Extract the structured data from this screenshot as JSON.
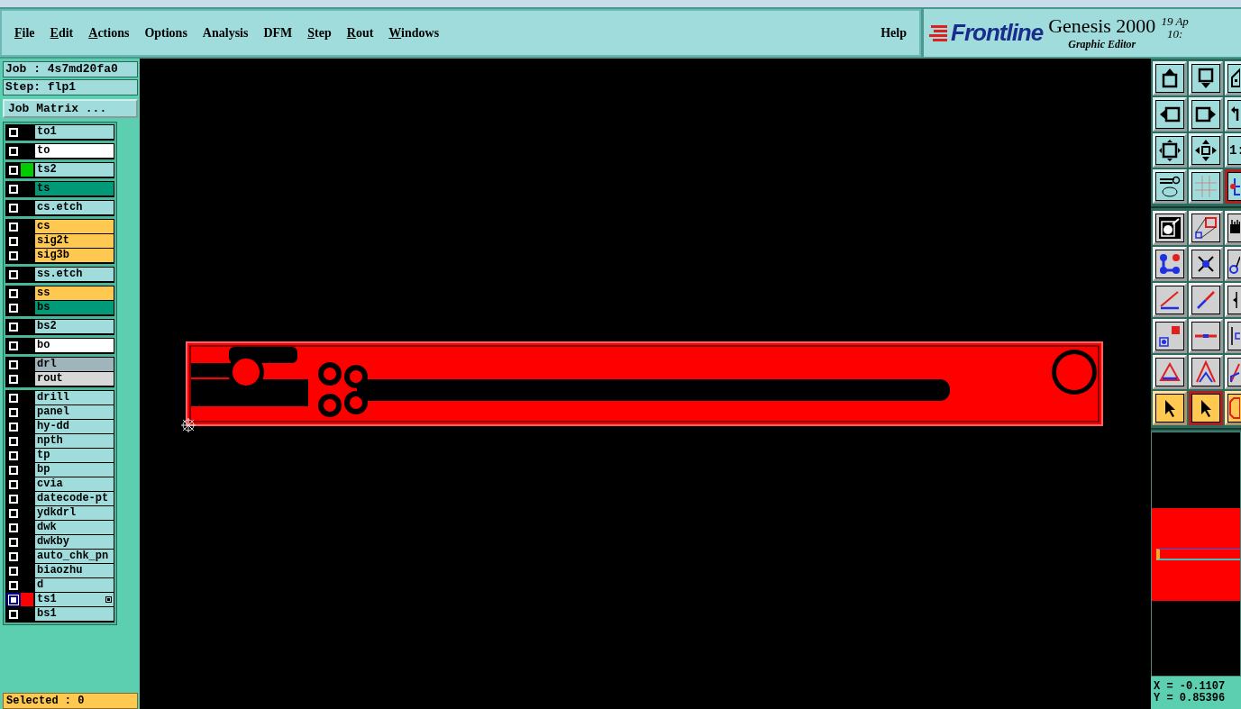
{
  "menu": [
    {
      "label": "File",
      "mnemonic": true
    },
    {
      "label": "Edit",
      "mnemonic": true
    },
    {
      "label": "Actions",
      "mnemonic": true
    },
    {
      "label": "Options",
      "mnemonic": false
    },
    {
      "label": "Analysis",
      "mnemonic": false
    },
    {
      "label": "DFM",
      "mnemonic": false
    },
    {
      "label": "Step",
      "mnemonic": true
    },
    {
      "label": "Rout",
      "mnemonic": true
    },
    {
      "label": "Windows",
      "mnemonic": true
    }
  ],
  "help": "Help",
  "brand": {
    "logo": "Frontline",
    "product": "Genesis 2000",
    "subtitle": "Graphic Editor",
    "date": "19 Ap",
    "time": "10:"
  },
  "job": "Job : 4s7md20fa0",
  "step": "Step: flp1",
  "job_matrix": "Job Matrix ...",
  "layer_groups": [
    {
      "layers": [
        {
          "name": "to1",
          "kind": "document",
          "selected": false
        }
      ]
    },
    {
      "layers": [
        {
          "name": "to",
          "kind": "silk",
          "selected": false
        }
      ]
    },
    {
      "layers": [
        {
          "name": "ts2",
          "kind": "document",
          "color": "#00cc00",
          "selected": false
        }
      ]
    },
    {
      "layers": [
        {
          "name": "ts",
          "kind": "mask",
          "selected": false
        }
      ]
    },
    {
      "layers": [
        {
          "name": "cs.etch",
          "kind": "document",
          "selected": false
        }
      ]
    },
    {
      "layers": [
        {
          "name": "cs",
          "kind": "signal",
          "selected": false
        },
        {
          "name": "sig2t",
          "kind": "signal",
          "selected": false
        },
        {
          "name": "sig3b",
          "kind": "signal",
          "selected": false
        }
      ]
    },
    {
      "layers": [
        {
          "name": "ss.etch",
          "kind": "document",
          "selected": false
        }
      ]
    },
    {
      "layers": [
        {
          "name": "ss",
          "kind": "signal",
          "selected": false
        },
        {
          "name": "bs",
          "kind": "mask",
          "selected": false
        }
      ]
    },
    {
      "layers": [
        {
          "name": "bs2",
          "kind": "document",
          "selected": false
        }
      ]
    },
    {
      "layers": [
        {
          "name": "bo",
          "kind": "silk",
          "selected": false
        }
      ]
    },
    {
      "layers": [
        {
          "name": "drl",
          "kind": "drill",
          "selected": false
        },
        {
          "name": "rout",
          "kind": "rout",
          "selected": false
        }
      ]
    },
    {
      "layers": [
        {
          "name": "drill",
          "kind": "document",
          "selected": false
        },
        {
          "name": "panel",
          "kind": "document",
          "selected": false
        },
        {
          "name": "hy-dd",
          "kind": "document",
          "selected": false
        },
        {
          "name": "npth",
          "kind": "document",
          "selected": false
        },
        {
          "name": "tp",
          "kind": "document",
          "selected": false
        },
        {
          "name": "bp",
          "kind": "document",
          "selected": false
        },
        {
          "name": "cvia",
          "kind": "document",
          "selected": false
        },
        {
          "name": "datecode-pt",
          "kind": "document",
          "selected": false
        },
        {
          "name": "ydkdrl",
          "kind": "document",
          "selected": false
        },
        {
          "name": "dwk",
          "kind": "document",
          "selected": false
        },
        {
          "name": "dwkby",
          "kind": "document",
          "selected": false
        },
        {
          "name": "auto_chk_pn",
          "kind": "document",
          "selected": false
        },
        {
          "name": "biaozhu",
          "kind": "document",
          "selected": false
        },
        {
          "name": "d",
          "kind": "document",
          "selected": false
        },
        {
          "name": "ts1",
          "kind": "document",
          "color": "#ff0000",
          "selected": true
        },
        {
          "name": "bs1",
          "kind": "document",
          "selected": false
        }
      ]
    }
  ],
  "status": "Selected : 0",
  "toolbar_groups": [
    {
      "buttons": [
        {
          "selected": false,
          "active": false
        },
        {
          "selected": false,
          "active": false
        },
        {
          "selected": false,
          "active": false
        },
        {
          "selected": false,
          "active": false
        },
        {
          "selected": false,
          "active": false
        },
        {
          "selected": false,
          "active": false
        },
        {
          "selected": false,
          "active": false
        },
        {
          "selected": false,
          "active": false
        },
        {
          "selected": false,
          "active": false,
          "label": "1:"
        },
        {
          "selected": false,
          "active": false
        },
        {
          "selected": false,
          "active": false
        },
        {
          "selected": true,
          "active": false
        }
      ]
    },
    {
      "buttons": [
        {
          "selected": false,
          "active": false
        },
        {
          "selected": false,
          "active": false
        },
        {
          "selected": false,
          "active": false
        },
        {
          "selected": false,
          "active": false
        },
        {
          "selected": false,
          "active": false
        },
        {
          "selected": false,
          "active": false
        },
        {
          "selected": false,
          "active": false
        },
        {
          "selected": false,
          "active": false
        },
        {
          "selected": false,
          "active": false
        },
        {
          "selected": false,
          "active": false
        },
        {
          "selected": false,
          "active": false
        },
        {
          "selected": false,
          "active": false
        },
        {
          "selected": false,
          "active": false
        },
        {
          "selected": false,
          "active": false
        },
        {
          "selected": false,
          "active": false
        },
        {
          "selected": false,
          "active": true
        },
        {
          "selected": true,
          "active": true
        },
        {
          "selected": false,
          "active": true
        }
      ]
    }
  ],
  "coords": {
    "x": "X = -0.1107",
    "y": "Y = 0.85396"
  }
}
